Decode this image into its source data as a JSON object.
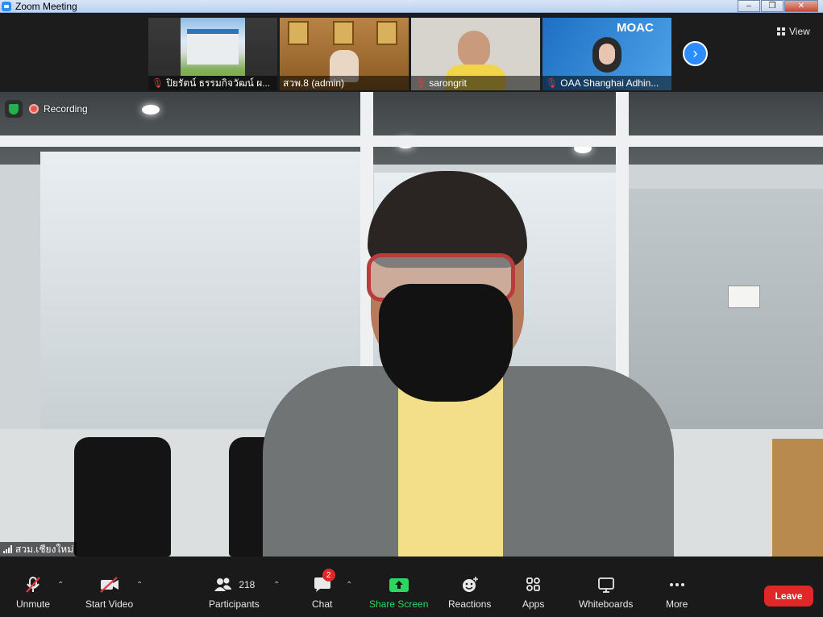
{
  "window": {
    "title": "Zoom Meeting"
  },
  "thumbnails": [
    {
      "name": "ปิยรัตน์ ธรรมกิจวัฒน์ ผ...",
      "muted": true
    },
    {
      "name": "สวพ.8 (admin)",
      "muted": false
    },
    {
      "name": "sarongrit",
      "muted": true
    },
    {
      "name": "OAA Shanghai Adhin...",
      "muted": true,
      "logo_text": "MOAC"
    }
  ],
  "top_bar": {
    "view_label": "View"
  },
  "main_video": {
    "recording_label": "Recording",
    "speaker_name": "สวม.เชียงใหม่",
    "sign_text": ""
  },
  "toolbar": {
    "unmute": "Unmute",
    "start_video": "Start Video",
    "participants": "Participants",
    "participants_count": "218",
    "chat": "Chat",
    "chat_badge": "2",
    "share_screen": "Share Screen",
    "reactions": "Reactions",
    "apps": "Apps",
    "whiteboards": "Whiteboards",
    "more": "More",
    "leave": "Leave"
  },
  "colors": {
    "accent": "#2d8cff",
    "leave": "#e02828",
    "share": "#2bd85f",
    "muted": "#e0393e"
  }
}
